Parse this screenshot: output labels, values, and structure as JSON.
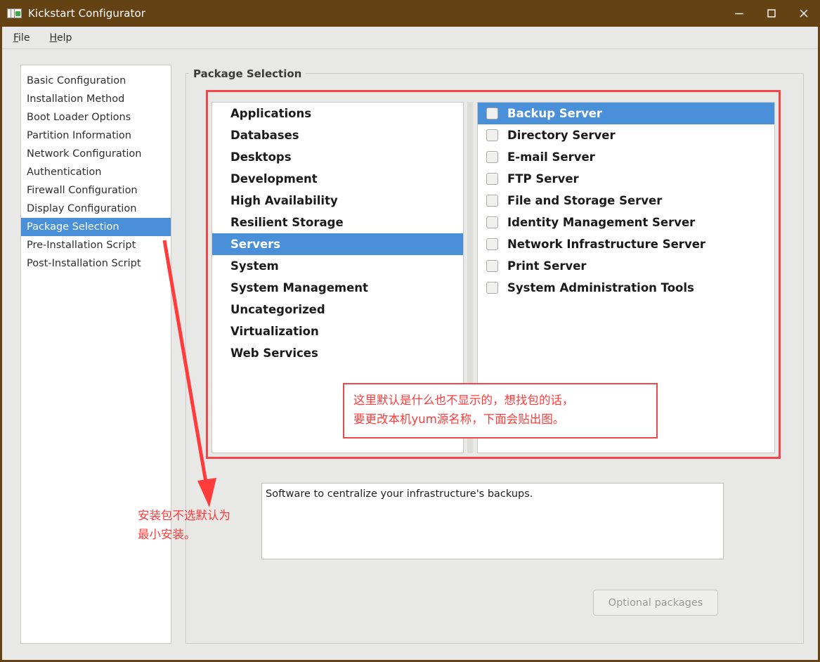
{
  "window": {
    "title": "Kickstart Configurator",
    "icon": "app-packages-icon",
    "titlebar_color": "#654214",
    "controls": {
      "minimize": "minimize",
      "maximize": "maximize",
      "close": "close"
    }
  },
  "menubar": {
    "items": [
      {
        "label": "File",
        "mnemonic": "F"
      },
      {
        "label": "Help",
        "mnemonic": "H"
      }
    ]
  },
  "sidebar": {
    "selected_index": 8,
    "items": [
      {
        "label": "Basic Configuration"
      },
      {
        "label": "Installation Method"
      },
      {
        "label": "Boot Loader Options"
      },
      {
        "label": "Partition Information"
      },
      {
        "label": "Network Configuration"
      },
      {
        "label": "Authentication"
      },
      {
        "label": "Firewall Configuration"
      },
      {
        "label": "Display Configuration"
      },
      {
        "label": "Package Selection"
      },
      {
        "label": "Pre-Installation Script"
      },
      {
        "label": "Post-Installation Script"
      }
    ]
  },
  "groupbox": {
    "label": "Package Selection"
  },
  "package_groups": {
    "selected_index": 7,
    "items": [
      {
        "label": "Applications"
      },
      {
        "label": "Databases"
      },
      {
        "label": "Desktops"
      },
      {
        "label": "Development"
      },
      {
        "label": "High Availability"
      },
      {
        "label": "Resilient Storage"
      },
      {
        "label": "Servers"
      },
      {
        "label": "System"
      },
      {
        "label": "System Management"
      },
      {
        "label": "Uncategorized"
      },
      {
        "label": "Virtualization"
      },
      {
        "label": "Web Services"
      }
    ]
  },
  "packages": {
    "selected_index": 0,
    "items": [
      {
        "label": "Backup Server",
        "checked": false
      },
      {
        "label": "Directory Server",
        "checked": false
      },
      {
        "label": "E-mail Server",
        "checked": false
      },
      {
        "label": "FTP Server",
        "checked": false
      },
      {
        "label": "File and Storage Server",
        "checked": false
      },
      {
        "label": "Identity Management Server",
        "checked": false
      },
      {
        "label": "Network Infrastructure Server",
        "checked": false
      },
      {
        "label": "Print Server",
        "checked": false
      },
      {
        "label": "System Administration Tools",
        "checked": false
      }
    ]
  },
  "description": {
    "text": "Software to centralize your infrastructure's backups."
  },
  "buttons": {
    "optional_packages": "Optional packages"
  },
  "annotations": {
    "accent_color": "#ff3b3b",
    "note_right": {
      "line1": "这里默认是什么也不显示的，想找包的话，",
      "line2": "要更改本机yum源名称，下面会贴出图。"
    },
    "note_left": {
      "line1": "安装包不选默认为",
      "line2": "最小安装。"
    }
  }
}
